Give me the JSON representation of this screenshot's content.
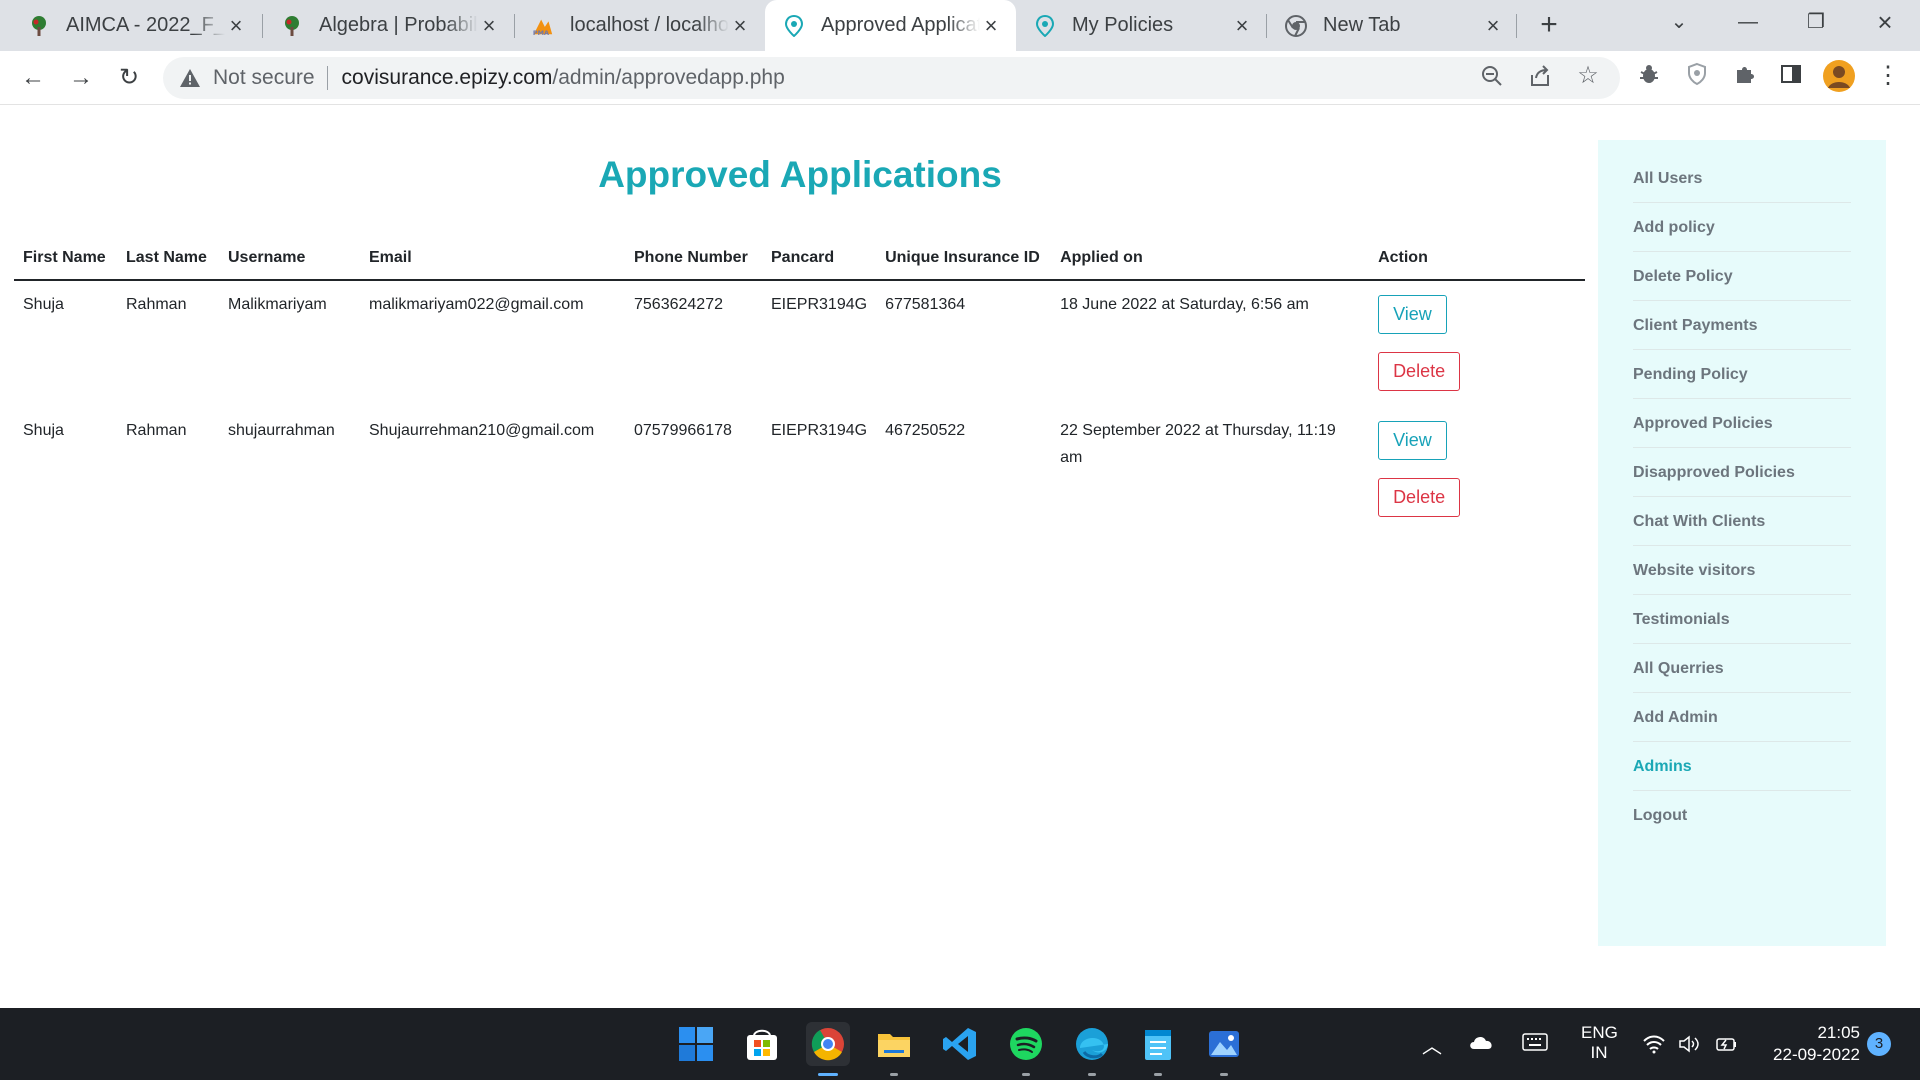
{
  "browser": {
    "tabs": [
      {
        "title": "AIMCA - 2022_F_Batch",
        "icon": "tree-logo-icon"
      },
      {
        "title": "Algebra | Probability",
        "icon": "tree-logo-icon"
      },
      {
        "title": "localhost / localhost",
        "icon": "phpmyadmin-icon"
      },
      {
        "title": "Approved Applications",
        "icon": "shield-pin-icon",
        "active": true
      },
      {
        "title": "My Policies",
        "icon": "shield-pin-icon"
      },
      {
        "title": "New Tab",
        "icon": "chrome-icon"
      }
    ],
    "address": {
      "security_label": "Not secure",
      "host": "covisurance.epizy.com",
      "path": "/admin/approvedapp.php"
    }
  },
  "page": {
    "heading": "Approved Applications",
    "table": {
      "columns": {
        "first_name": "First Name",
        "last_name": "Last Name",
        "username": "Username",
        "email": "Email",
        "phone": "Phone Number",
        "pancard": "Pancard",
        "insurance_id": "Unique Insurance ID",
        "applied_on": "Applied on",
        "action": "Action"
      },
      "rows": [
        {
          "first_name": "Shuja",
          "last_name": "Rahman",
          "username": "Malikmariyam",
          "email": "malikmariyam022@gmail.com",
          "phone": "7563624272",
          "pancard": "EIEPR3194G",
          "insurance_id": "677581364",
          "applied_on": "18 June 2022 at Saturday, 6:56 am",
          "view_label": "View",
          "delete_label": "Delete"
        },
        {
          "first_name": "Shuja",
          "last_name": "Rahman",
          "username": "shujaurrahman",
          "email": "Shujaurrehman210@gmail.com",
          "phone": "07579966178",
          "pancard": "EIEPR3194G",
          "insurance_id": "467250522",
          "applied_on": "22 September 2022 at Thursday, 11:19 am",
          "view_label": "View",
          "delete_label": "Delete"
        }
      ]
    },
    "sidebar": {
      "items": [
        {
          "label": "All Users"
        },
        {
          "label": "Add policy"
        },
        {
          "label": "Delete Policy"
        },
        {
          "label": "Client Payments"
        },
        {
          "label": "Pending Policy"
        },
        {
          "label": "Approved Policies"
        },
        {
          "label": "Disapproved Policies"
        },
        {
          "label": "Chat With Clients"
        },
        {
          "label": "Website visitors"
        },
        {
          "label": "Testimonials"
        },
        {
          "label": "All Querries"
        },
        {
          "label": "Add Admin"
        },
        {
          "label": "Admins",
          "active": true
        },
        {
          "label": "Logout"
        }
      ]
    }
  },
  "taskbar": {
    "apps": [
      "windows-start-icon",
      "microsoft-store-icon",
      "chrome-icon",
      "file-explorer-icon",
      "vscode-icon",
      "spotify-icon",
      "edge-icon",
      "notepad-icon",
      "photos-icon"
    ],
    "language": "ENG",
    "region": "IN",
    "time": "21:05",
    "date": "22-09-2022",
    "notification_count": "3"
  },
  "colors": {
    "accent": "#1aa8b5",
    "view_button": "#17a2b8",
    "delete_button": "#dc3545",
    "sidebar_bg": "#e7fbfb",
    "tabstrip_bg": "#dee1e6",
    "taskbar_bg": "#1c1f24"
  }
}
